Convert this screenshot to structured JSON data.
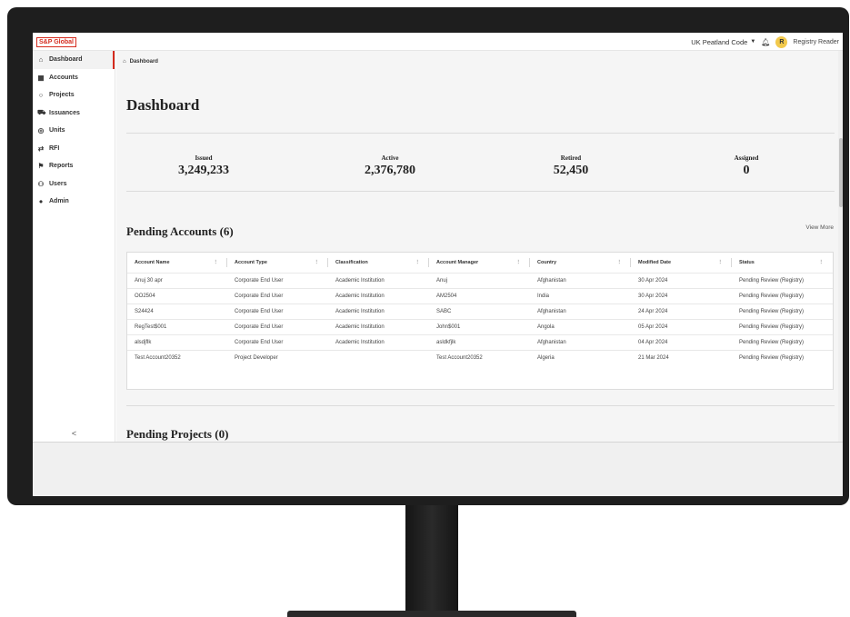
{
  "header": {
    "logo": "S&P Global",
    "registry_code": "UK Peatland Code",
    "user_initial": "R",
    "user_name": "Registry Reader"
  },
  "sidebar": {
    "items": [
      {
        "label": "Dashboard",
        "icon": "home-icon"
      },
      {
        "label": "Accounts",
        "icon": "accounts-icon"
      },
      {
        "label": "Projects",
        "icon": "projects-icon"
      },
      {
        "label": "Issuances",
        "icon": "issuances-icon"
      },
      {
        "label": "Units",
        "icon": "units-icon"
      },
      {
        "label": "RFI",
        "icon": "rfi-icon"
      },
      {
        "label": "Reports",
        "icon": "flag-icon"
      },
      {
        "label": "Users",
        "icon": "users-icon"
      },
      {
        "label": "Admin",
        "icon": "admin-icon"
      }
    ],
    "collapse": "<"
  },
  "breadcrumb": "Dashboard",
  "page_title": "Dashboard",
  "stats": [
    {
      "label": "Issued",
      "value": "3,249,233"
    },
    {
      "label": "Active",
      "value": "2,376,780"
    },
    {
      "label": "Retired",
      "value": "52,450"
    },
    {
      "label": "Assigned",
      "value": "0"
    }
  ],
  "pending_accounts": {
    "title": "Pending Accounts (6)",
    "view_more": "View More",
    "columns": [
      "Account Name",
      "Account Type",
      "Classification",
      "Account Manager",
      "Country",
      "Modified Date",
      "Status"
    ],
    "rows": [
      [
        "Anuj 30 apr",
        "Corporate End User",
        "Academic Institution",
        "Anuj",
        "Afghanistan",
        "30 Apr 2024",
        "Pending Review (Registry)"
      ],
      [
        "OO2504",
        "Corporate End User",
        "Academic Institution",
        "AM2504",
        "India",
        "30 Apr 2024",
        "Pending Review (Registry)"
      ],
      [
        "S24424",
        "Corporate End User",
        "Academic Institution",
        "SABC",
        "Afghanistan",
        "24 Apr 2024",
        "Pending Review (Registry)"
      ],
      [
        "RegTest$001",
        "Corporate End User",
        "Academic Institution",
        "John$001",
        "Angola",
        "05 Apr 2024",
        "Pending Review (Registry)"
      ],
      [
        "alsdjflk",
        "Corporate End User",
        "Academic Institution",
        "asldkfjlk",
        "Afghanistan",
        "04 Apr 2024",
        "Pending Review (Registry)"
      ],
      [
        "Test Account20352",
        "Project Developer",
        "",
        "Test Account20352",
        "Algeria",
        "21 Mar 2024",
        "Pending Review (Registry)"
      ]
    ]
  },
  "pending_projects": {
    "title": "Pending Projects (0)"
  },
  "colors": {
    "brand": "#d52b1e",
    "avatar": "#f2c94c",
    "monitor": "#1e1e1e"
  }
}
